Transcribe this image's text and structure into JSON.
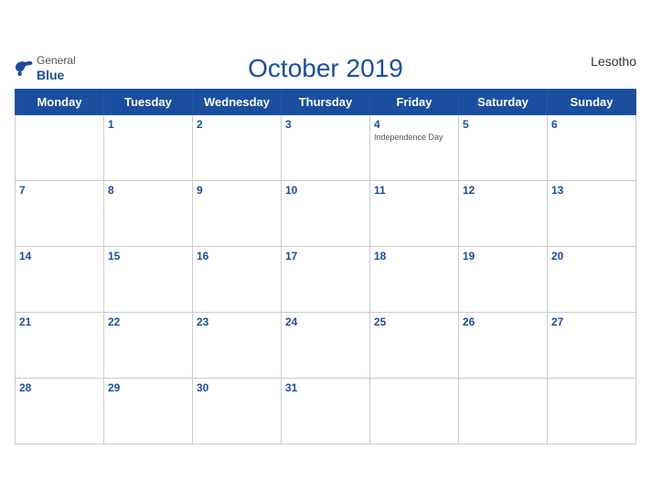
{
  "brand": {
    "general": "General",
    "blue": "Blue",
    "bird_icon": "bird"
  },
  "header": {
    "title": "October 2019",
    "country": "Lesotho"
  },
  "weekdays": [
    "Monday",
    "Tuesday",
    "Wednesday",
    "Thursday",
    "Friday",
    "Saturday",
    "Sunday"
  ],
  "weeks": [
    [
      {
        "day": "",
        "holiday": ""
      },
      {
        "day": "1",
        "holiday": ""
      },
      {
        "day": "2",
        "holiday": ""
      },
      {
        "day": "3",
        "holiday": ""
      },
      {
        "day": "4",
        "holiday": "Independence Day"
      },
      {
        "day": "5",
        "holiday": ""
      },
      {
        "day": "6",
        "holiday": ""
      }
    ],
    [
      {
        "day": "7",
        "holiday": ""
      },
      {
        "day": "8",
        "holiday": ""
      },
      {
        "day": "9",
        "holiday": ""
      },
      {
        "day": "10",
        "holiday": ""
      },
      {
        "day": "11",
        "holiday": ""
      },
      {
        "day": "12",
        "holiday": ""
      },
      {
        "day": "13",
        "holiday": ""
      }
    ],
    [
      {
        "day": "14",
        "holiday": ""
      },
      {
        "day": "15",
        "holiday": ""
      },
      {
        "day": "16",
        "holiday": ""
      },
      {
        "day": "17",
        "holiday": ""
      },
      {
        "day": "18",
        "holiday": ""
      },
      {
        "day": "19",
        "holiday": ""
      },
      {
        "day": "20",
        "holiday": ""
      }
    ],
    [
      {
        "day": "21",
        "holiday": ""
      },
      {
        "day": "22",
        "holiday": ""
      },
      {
        "day": "23",
        "holiday": ""
      },
      {
        "day": "24",
        "holiday": ""
      },
      {
        "day": "25",
        "holiday": ""
      },
      {
        "day": "26",
        "holiday": ""
      },
      {
        "day": "27",
        "holiday": ""
      }
    ],
    [
      {
        "day": "28",
        "holiday": ""
      },
      {
        "day": "29",
        "holiday": ""
      },
      {
        "day": "30",
        "holiday": ""
      },
      {
        "day": "31",
        "holiday": ""
      },
      {
        "day": "",
        "holiday": ""
      },
      {
        "day": "",
        "holiday": ""
      },
      {
        "day": "",
        "holiday": ""
      }
    ]
  ],
  "colors": {
    "header_bg": "#1a4fa0",
    "accent": "#1a4fa0"
  }
}
